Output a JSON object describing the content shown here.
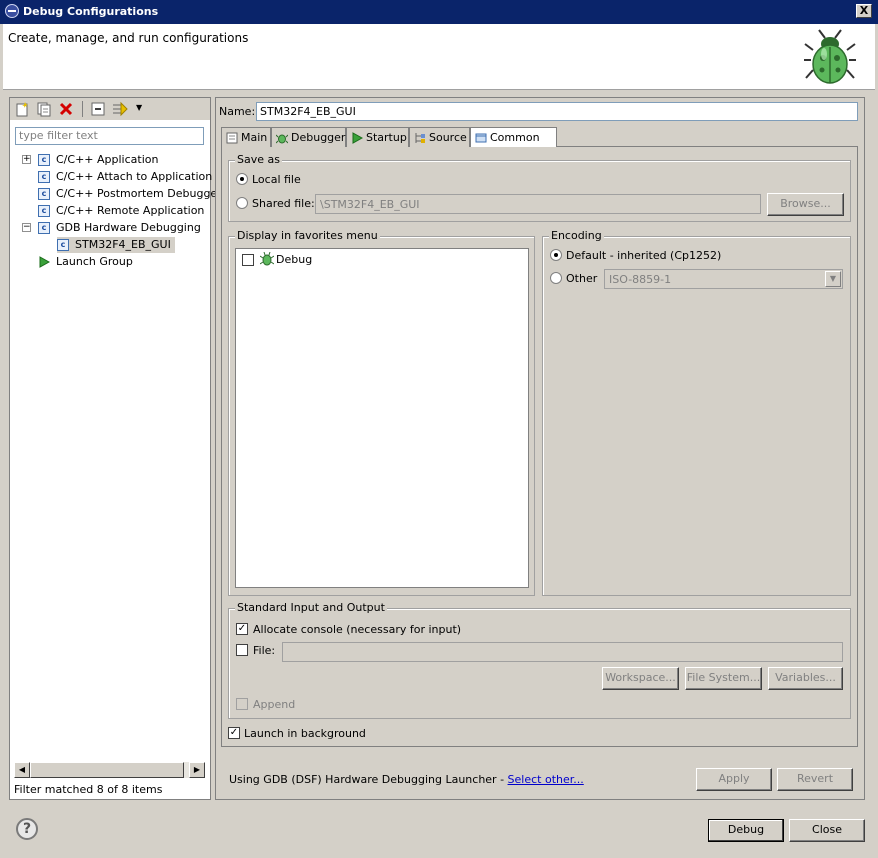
{
  "window": {
    "title": "Debug Configurations",
    "close_glyph": "X"
  },
  "banner": {
    "text": "Create, manage, and run configurations"
  },
  "left": {
    "filter_placeholder": "type filter text",
    "tree": [
      {
        "label": "C/C++ Application",
        "icon": "c-config-icon",
        "expander": "+"
      },
      {
        "label": "C/C++ Attach to Application",
        "icon": "c-config-icon"
      },
      {
        "label": "C/C++ Postmortem Debugger",
        "icon": "c-config-icon"
      },
      {
        "label": "C/C++ Remote Application",
        "icon": "c-config-icon"
      },
      {
        "label": "GDB Hardware Debugging",
        "icon": "c-config-icon",
        "expander": "−"
      },
      {
        "label": "STM32F4_EB_GUI",
        "icon": "c-config-icon",
        "selected": true
      },
      {
        "label": "Launch Group",
        "icon": "launch-group-icon"
      }
    ],
    "filter_status": "Filter matched 8 of 8 items"
  },
  "right": {
    "name_label": "Name:",
    "name_value": "STM32F4_EB_GUI",
    "tabs": [
      {
        "label": "Main",
        "icon": "main-tab-icon"
      },
      {
        "label": "Debugger",
        "icon": "debugger-tab-icon"
      },
      {
        "label": "Startup",
        "icon": "startup-tab-icon"
      },
      {
        "label": "Source",
        "icon": "source-tab-icon"
      },
      {
        "label": "Common",
        "icon": "common-tab-icon",
        "active": true
      }
    ],
    "save_as": {
      "title": "Save as",
      "local_file": "Local file",
      "shared_file": "Shared file:",
      "shared_value": "\\STM32F4_EB_GUI",
      "browse": "Browse..."
    },
    "favorites": {
      "title": "Display in favorites menu",
      "items": [
        {
          "label": "Debug",
          "checked": false
        }
      ]
    },
    "encoding": {
      "title": "Encoding",
      "default": "Default - inherited (Cp1252)",
      "other": "Other",
      "other_value": "ISO-8859-1"
    },
    "stdio": {
      "title": "Standard Input and Output",
      "allocate": "Allocate console (necessary for input)",
      "file": "File:",
      "workspace": "Workspace...",
      "filesystem": "File System...",
      "variables": "Variables...",
      "append": "Append"
    },
    "launch_bg": "Launch in background",
    "launcher_text": "Using GDB (DSF) Hardware Debugging Launcher - ",
    "select_other": "Select other...",
    "apply": "Apply",
    "revert": "Revert"
  },
  "footer": {
    "help": "?",
    "debug": "Debug",
    "close": "Close"
  },
  "colors": {
    "titlebar": "#0a246a",
    "face": "#d4d0c8",
    "link": "#0000cc"
  }
}
